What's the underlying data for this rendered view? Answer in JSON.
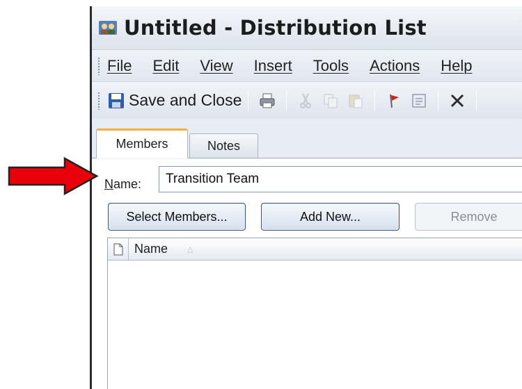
{
  "window": {
    "title": "Untitled - Distribution List"
  },
  "menu": [
    "File",
    "Edit",
    "View",
    "Insert",
    "Tools",
    "Actions",
    "Help"
  ],
  "toolbar": {
    "save_label": "Save and Close"
  },
  "tabs": {
    "members": "Members",
    "notes": "Notes"
  },
  "form": {
    "name_label_first": "N",
    "name_label_rest": "ame:",
    "name_value": "Transition Team"
  },
  "buttons": {
    "select_members": "Select Members...",
    "add_new": "Add New...",
    "remove": "Remove"
  },
  "list": {
    "column_name": "Name",
    "sort_glyph": "△"
  },
  "colors": {
    "arrow": "#e8000b",
    "active_tab_accent": "#f0b040"
  }
}
